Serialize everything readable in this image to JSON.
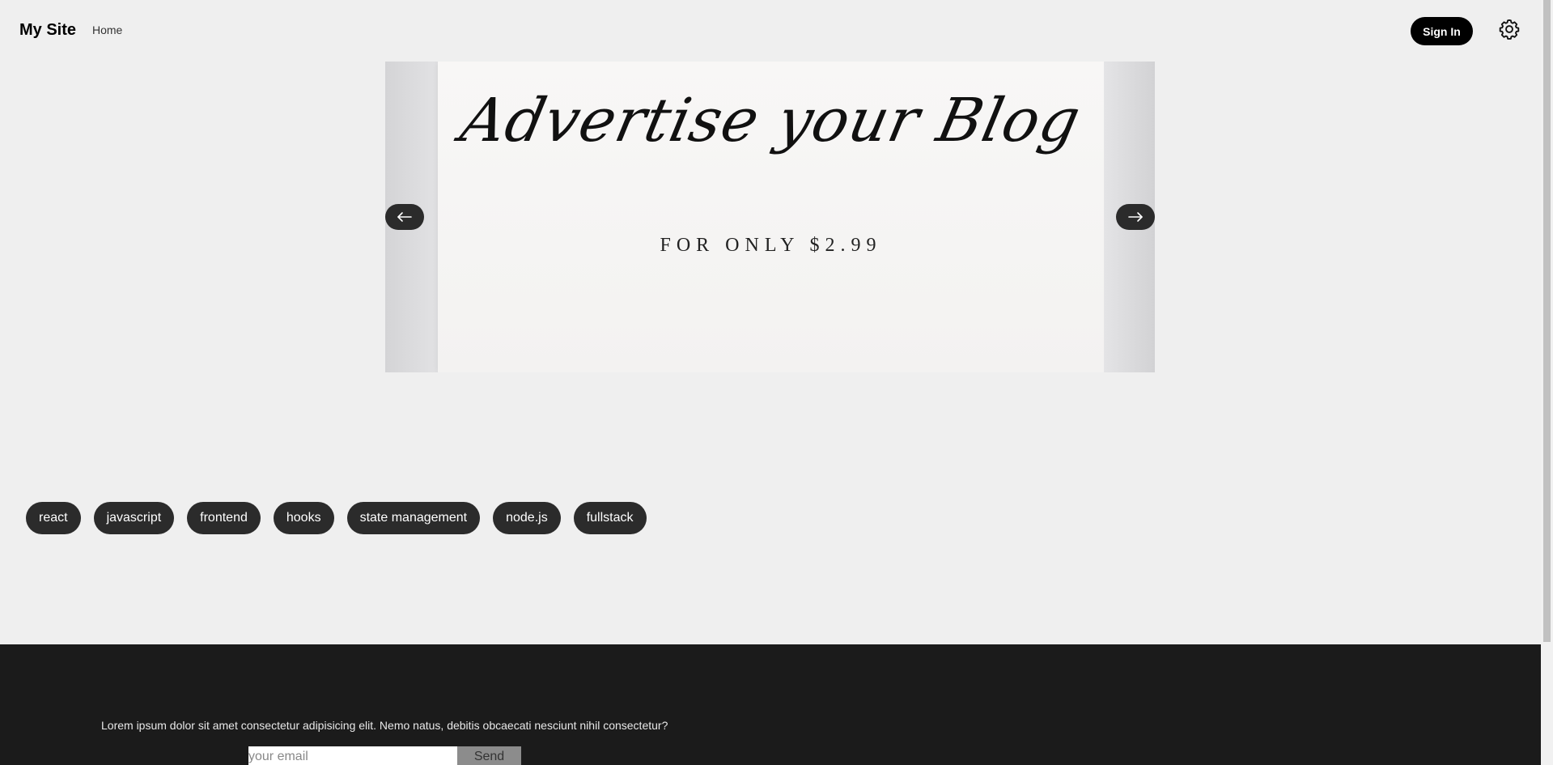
{
  "header": {
    "brand": "My Site",
    "nav": [
      {
        "label": "Home"
      }
    ],
    "signin_label": "Sign In",
    "settings_icon": "gear-icon"
  },
  "carousel": {
    "headline": "Advertise your Blog",
    "subline": "FOR ONLY $2.99",
    "prev_icon": "arrow-left-icon",
    "next_icon": "arrow-right-icon"
  },
  "tags": [
    "react",
    "javascript",
    "frontend",
    "hooks",
    "state management",
    "node.js",
    "fullstack"
  ],
  "footer": {
    "text": "Lorem ipsum dolor sit amet consectetur adipisicing elit. Nemo natus, debitis obcaecati nesciunt nihil consectetur?",
    "email_placeholder": "your email",
    "send_label": "Send"
  },
  "colors": {
    "page_bg": "#efefef",
    "footer_bg": "#1b1b1b",
    "pill_bg": "#2b2b2b",
    "signin_bg": "#000000"
  }
}
